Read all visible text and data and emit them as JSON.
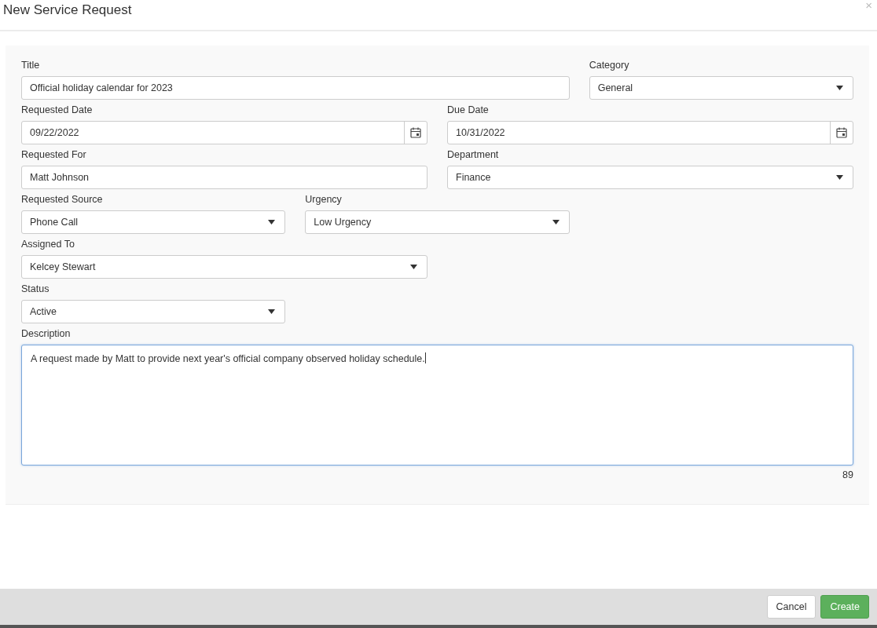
{
  "dialog": {
    "title": "New Service Request",
    "close": "×"
  },
  "rows": [
    {
      "fields": [
        {
          "label": "Title",
          "kind": "text",
          "value": "Official holiday calendar for 2023"
        },
        {
          "label": "Category",
          "kind": "select",
          "value": "General"
        }
      ]
    },
    {
      "fields": [
        {
          "label": "Requested Date",
          "kind": "date",
          "value": "09/22/2022"
        },
        {
          "label": "Due Date",
          "kind": "date",
          "value": "10/31/2022"
        }
      ]
    },
    {
      "fields": [
        {
          "label": "Requested For",
          "kind": "text",
          "value": "Matt Johnson"
        },
        {
          "label": "Department",
          "kind": "select",
          "value": "Finance"
        }
      ]
    },
    {
      "fields": [
        {
          "label": "Requested Source",
          "kind": "select",
          "value": "Phone Call"
        },
        {
          "label": "Urgency",
          "kind": "select",
          "value": "Low Urgency"
        }
      ]
    },
    {
      "fields": [
        {
          "label": "Assigned To",
          "kind": "select",
          "value": "Kelcey Stewart"
        }
      ]
    },
    {
      "fields": [
        {
          "label": "Status",
          "kind": "select",
          "value": "Active"
        }
      ]
    }
  ],
  "description": {
    "label": "Description",
    "value": "A request made by Matt to provide next year's official company observed holiday schedule.",
    "focused": true,
    "count": "89"
  },
  "buttons": [
    {
      "label": "Cancel",
      "kind": "secondary"
    },
    {
      "label": "Create",
      "kind": "primary"
    }
  ]
}
